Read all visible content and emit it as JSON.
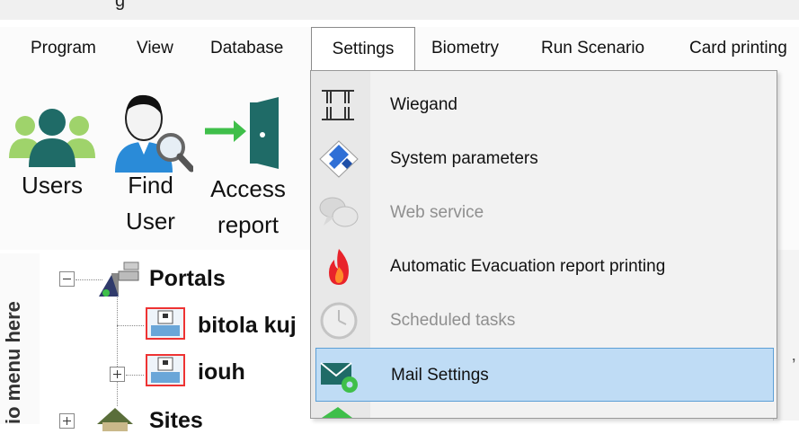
{
  "window": {
    "title_fragment": "g"
  },
  "menubar": {
    "items": [
      {
        "label": "Program"
      },
      {
        "label": "View"
      },
      {
        "label": "Database"
      },
      {
        "label": "Settings"
      },
      {
        "label": "Biometry"
      },
      {
        "label": "Run Scenario"
      },
      {
        "label": "Card printing"
      }
    ],
    "active": "Settings"
  },
  "ribbon": {
    "users": {
      "line1": "Users"
    },
    "find_user": {
      "line1": "Find",
      "line2": "User"
    },
    "access_report": {
      "line1": "Access",
      "line2": "report"
    }
  },
  "left_panel": {
    "vertical_text": "io menu here"
  },
  "tree": {
    "nodes": [
      {
        "label": "Portals",
        "icon": "portal-camera-icon"
      },
      {
        "label": "bitola kuj",
        "icon": "device-icon"
      },
      {
        "label": "iouh",
        "icon": "device-icon"
      },
      {
        "label": "Sites",
        "icon": "sites-icon"
      }
    ]
  },
  "right_panel": {
    "caption": "’"
  },
  "settings_menu": {
    "items": [
      {
        "label": "Wiegand",
        "icon": "wiegand-icon",
        "enabled": true,
        "selected": false
      },
      {
        "label": "System parameters",
        "icon": "diamond-icon",
        "enabled": true,
        "selected": false
      },
      {
        "label": "Web service",
        "icon": "chat-bubbles-icon",
        "enabled": false,
        "selected": false
      },
      {
        "label": "Automatic Evacuation report printing",
        "icon": "fire-icon",
        "enabled": true,
        "selected": false
      },
      {
        "label": "Scheduled tasks",
        "icon": "clock-icon",
        "enabled": false,
        "selected": false
      },
      {
        "label": "Mail Settings",
        "icon": "mail-gear-icon",
        "enabled": true,
        "selected": true
      }
    ]
  },
  "colors": {
    "menu_selection_bg": "#bfdcf5",
    "menu_selection_border": "#5c9fd6",
    "users_icon_teal": "#1f6b67",
    "users_icon_green": "#9fd36b",
    "access_icon_green": "#3fbf4a",
    "device_icon_border": "#e33333",
    "fire_red": "#e8232b"
  }
}
